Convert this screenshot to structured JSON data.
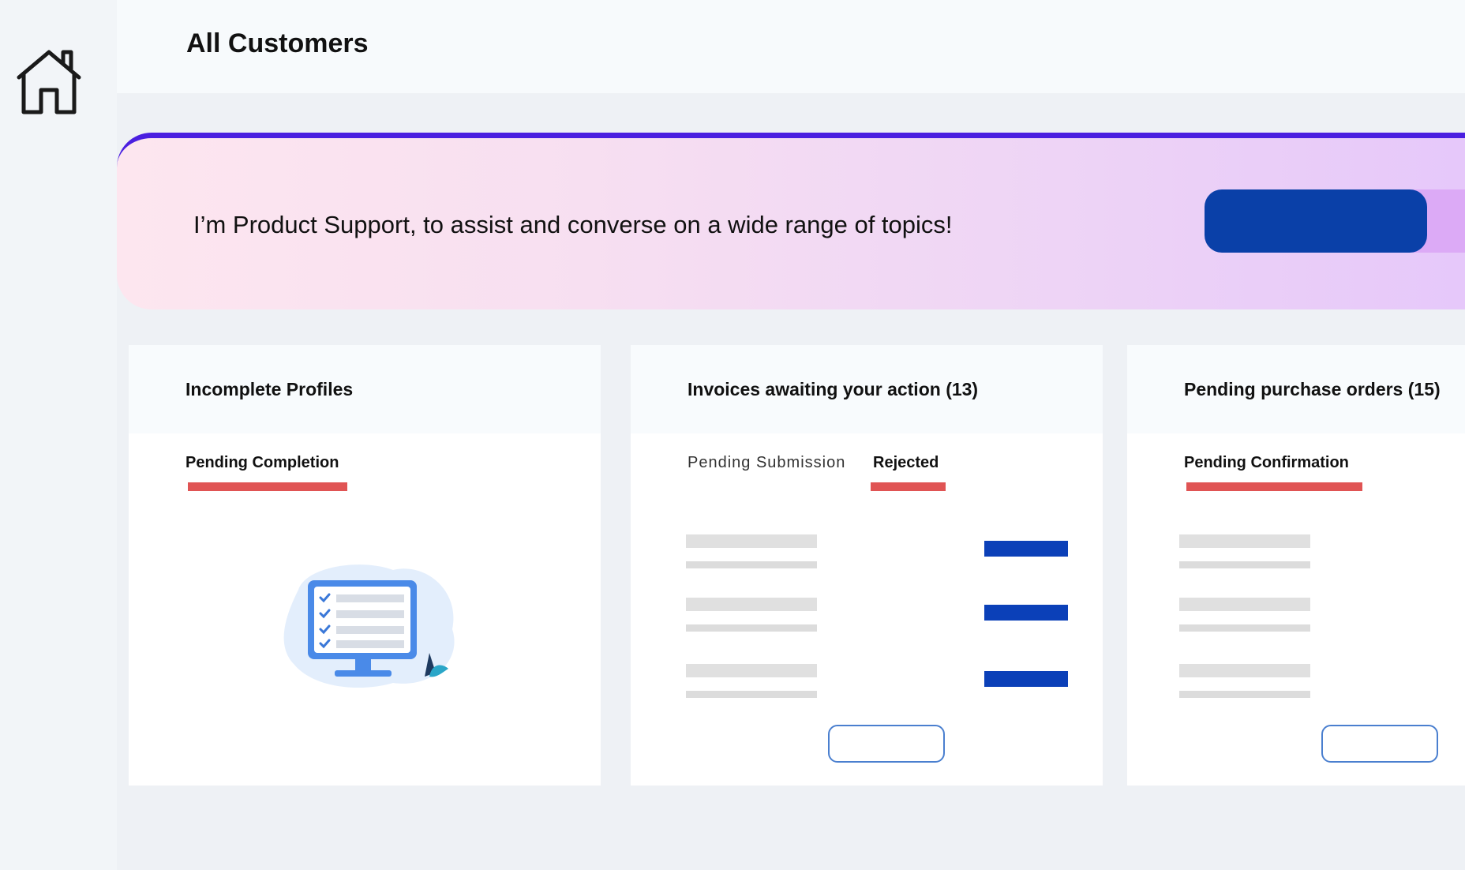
{
  "header": {
    "title": "All Customers"
  },
  "icons": {
    "home": "home-icon",
    "illustration": "monitor-checklist-icon"
  },
  "banner": {
    "message": "I’m Product Support, to assist and converse on a wide range of topics!",
    "accent_color": "#4a1fe0",
    "cta_color": "#0a40a8"
  },
  "cards": [
    {
      "title": "Incomplete Profiles",
      "tabs": [
        {
          "label": "Pending Completion",
          "active": true
        }
      ]
    },
    {
      "title": "Invoices awaiting your action (13)",
      "tabs": [
        {
          "label": "Pending Submission",
          "active": false
        },
        {
          "label": "Rejected",
          "active": true
        }
      ]
    },
    {
      "title": "Pending purchase orders (15)",
      "tabs": [
        {
          "label": "Pending Confirmation",
          "active": true
        }
      ]
    }
  ],
  "colors": {
    "tab_underline": "#e05454",
    "action_bar": "#0b40b8",
    "outline_button": "#4a7fcf"
  }
}
